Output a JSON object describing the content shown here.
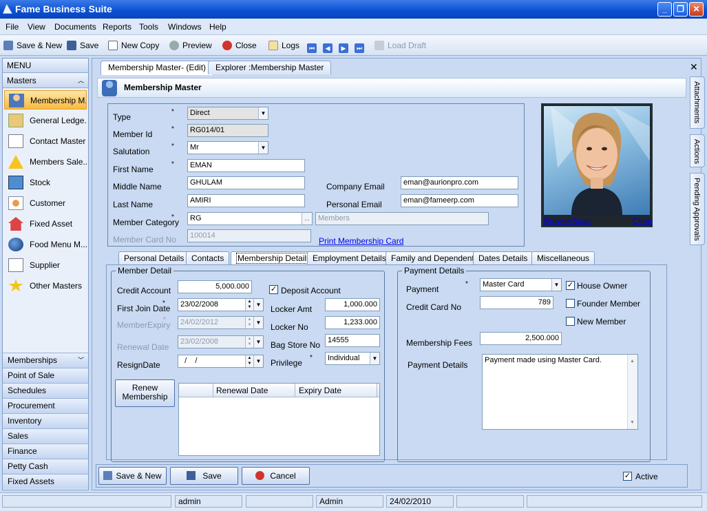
{
  "window": {
    "title": "Fame Business Suite"
  },
  "menu": [
    "File",
    "View",
    "Documents",
    "Reports",
    "Tools",
    "Windows",
    "Help"
  ],
  "toolbar": {
    "save_new": "Save & New",
    "save": "Save",
    "new_copy": "New Copy",
    "preview": "Preview",
    "close": "Close",
    "logs": "Logs",
    "load_draft": "Load Draft"
  },
  "sidebar": {
    "header": "MENU",
    "section": "Masters",
    "items": [
      "Membership M...",
      "General Ledge...",
      "Contact Master",
      "Members Sale...",
      "Stock",
      "Customer",
      "Fixed Asset",
      "Food Menu M...",
      "Supplier",
      "Other Masters"
    ],
    "groups": [
      "Memberships",
      "Point of Sale",
      "Schedules",
      "Procurement",
      "Inventory",
      "Sales",
      "Finance",
      "Petty Cash",
      "Fixed Assets"
    ]
  },
  "doc_tabs": [
    "Membership Master- (Edit)",
    "Explorer :Membership Master"
  ],
  "form": {
    "header": "Membership Master",
    "labels": {
      "type": "Type",
      "member_id": "Member Id",
      "salutation": "Salutation",
      "first_name": "First Name",
      "middle_name": "Middle Name",
      "last_name": "Last Name",
      "member_category": "Member Category",
      "member_card_no": "Member Card No",
      "company_email": "Company Email",
      "personal_email": "Personal Email"
    },
    "values": {
      "type": "Direct",
      "member_id": "RG014/01",
      "salutation": "Mr",
      "first_name": "EMAN",
      "middle_name": "GHULAM",
      "last_name": "AMIRI",
      "member_category": "RG",
      "category_name": "Members",
      "member_card_no": "100014",
      "company_email": "eman@aurionpro.com",
      "personal_email": "eman@fameerp.com"
    },
    "required_mark": "*",
    "print_card": "Print Membership Card",
    "photo_links": {
      "browse": "Browse",
      "scan": "Scan",
      "clear": "Clear"
    }
  },
  "content_tabs": [
    "Personal Details",
    "Contacts",
    "Membership Details",
    "Employment Details",
    "Family and Dependent",
    "Dates Details",
    "Miscellaneous"
  ],
  "member_detail": {
    "legend": "Member Detail",
    "labels": {
      "credit_account": "Credit Account",
      "first_join_date": "First Join Date",
      "member_expiry": "MemberExpiry",
      "renewal_date": "Renewal Date",
      "resign_date": "ResignDate",
      "deposit_account": "Deposit Account",
      "locker_amt": "Locker Amt",
      "locker_no": "Locker No",
      "bag_store_no": "Bag Store No",
      "privilege": "Privilege"
    },
    "values": {
      "credit_account": "5,000.000",
      "first_join_date": "23/02/2008",
      "member_expiry": "24/02/2012",
      "renewal_date": "23/02/2008",
      "resign_date": "  /    /",
      "locker_amt": "1,000.000",
      "locker_no": "1,233.000",
      "bag_store_no": "14555",
      "privilege": "Individual"
    },
    "deposit_checked": true,
    "renew_button": "Renew Membership",
    "grid_columns": [
      "Renewal Date",
      "Expiry Date"
    ]
  },
  "payment_details": {
    "legend": "Payment Details",
    "labels": {
      "payment": "Payment",
      "credit_card_no": "Credit Card No",
      "membership_fees": "Membership Fees",
      "payment_details": "Payment Details",
      "house_owner": "House Owner",
      "founder_member": "Founder Member",
      "new_member": "New Member"
    },
    "values": {
      "payment": "Master Card",
      "credit_card_no": "789",
      "membership_fees": "2,500.000",
      "payment_details": "Payment made using Master Card."
    },
    "house_owner": true,
    "founder_member": false,
    "new_member": false
  },
  "bottom": {
    "save_new": "Save & New",
    "save": "Save",
    "cancel": "Cancel",
    "active": "Active",
    "active_checked": true
  },
  "right_tabs": [
    "Attachments",
    "Actions",
    "Pending Approvals"
  ],
  "status": [
    "admin",
    "Admin",
    "24/02/2010"
  ],
  "colors": {
    "title_bar": "#0a4fd0",
    "selected_item": "#f8b942",
    "workspace": "#c9daf2"
  }
}
